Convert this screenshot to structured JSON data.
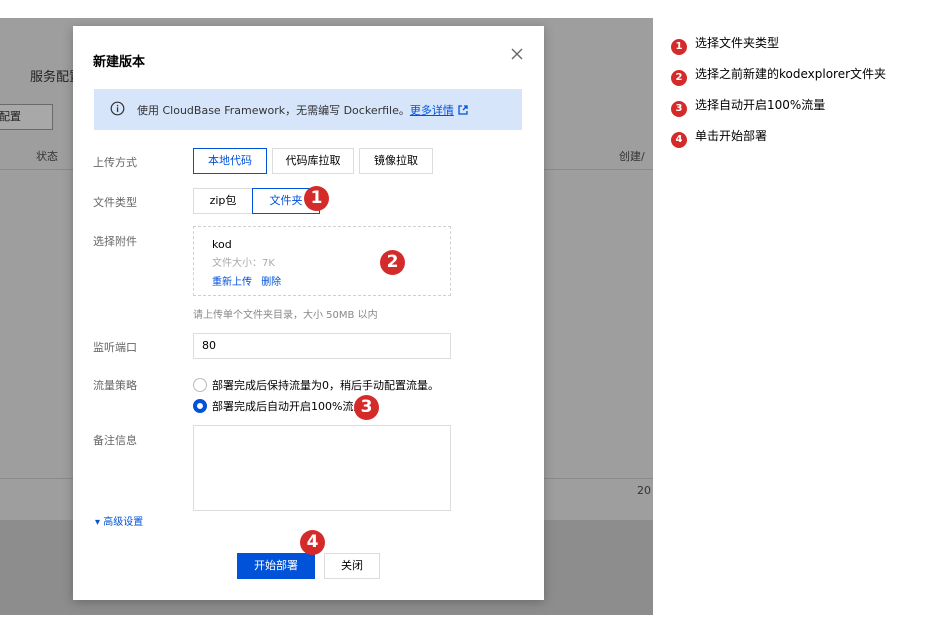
{
  "background": {
    "title": "服务配置",
    "config_button": "配置",
    "col_status": "状态",
    "col_created": "创建/",
    "cell_value": "20"
  },
  "modal": {
    "title": "新建版本",
    "close_icon": "close-icon",
    "info": {
      "icon": "info-circle-icon",
      "text": "使用 CloudBase Framework，无需编写 Dockerfile。",
      "link": "更多详情",
      "link_icon": "external-link-icon"
    },
    "upload_method": {
      "label": "上传方式",
      "options": [
        "本地代码",
        "代码库拉取",
        "镜像拉取"
      ],
      "selected": "本地代码"
    },
    "file_type": {
      "label": "文件类型",
      "options": [
        "zip包",
        "文件夹"
      ],
      "selected": "文件夹"
    },
    "attachment": {
      "label": "选择附件",
      "file_name": "kod",
      "file_size": "文件大小：7K",
      "reupload": "重新上传",
      "delete": "删除",
      "hint": "请上传单个文件夹目录，大小 50MB 以内"
    },
    "port": {
      "label": "监听端口",
      "value": "80"
    },
    "traffic": {
      "label": "流量策略",
      "options": [
        "部署完成后保持流量为0，稍后手动配置流量。",
        "部署完成后自动开启100%流量"
      ],
      "selected_index": 1
    },
    "remark": {
      "label": "备注信息",
      "value": ""
    },
    "advanced": "▾ 高级设置",
    "deploy_button": "开始部署",
    "close_button": "关闭"
  },
  "badges": [
    "1",
    "2",
    "3",
    "4"
  ],
  "steps": [
    {
      "num": "1",
      "text": "选择文件夹类型"
    },
    {
      "num": "2",
      "text": "选择之前新建的kodexplorer文件夹"
    },
    {
      "num": "3",
      "text": "选择自动开启100%流量"
    },
    {
      "num": "4",
      "text": "单击开始部署"
    }
  ],
  "colors": {
    "accent": "#0052d9",
    "badge": "#d52a2a",
    "info_bg": "#d7e5fb",
    "overlay": "#8d8d8d"
  }
}
